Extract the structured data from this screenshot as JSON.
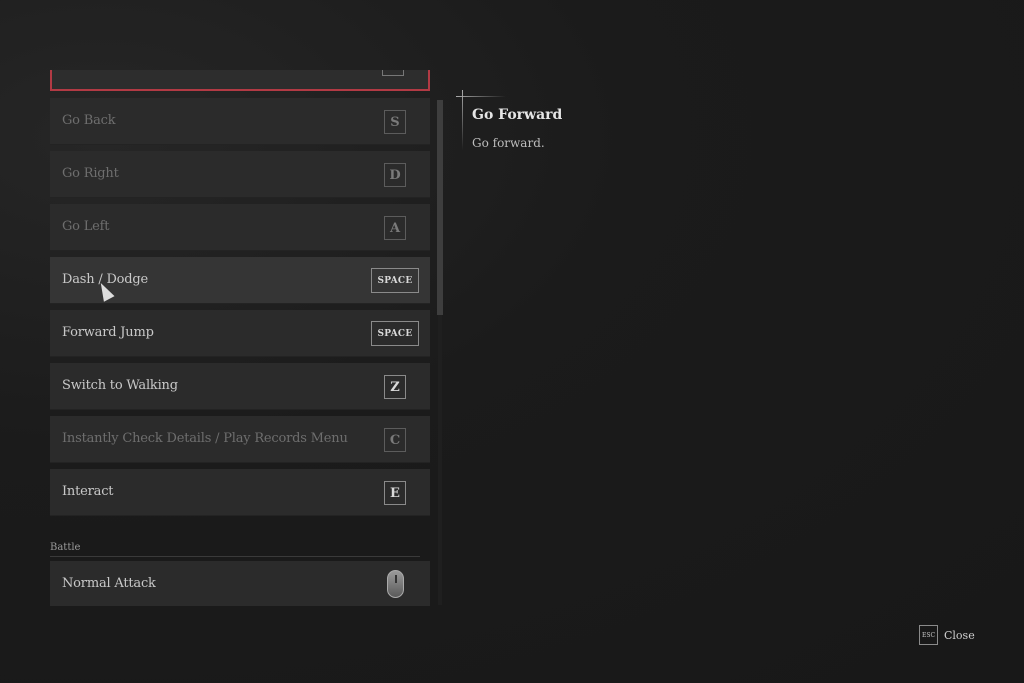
{
  "controls": {
    "rows": [
      {
        "label": "",
        "key": "",
        "state": "selected"
      },
      {
        "label": "Go Back",
        "key": "S",
        "state": "dim"
      },
      {
        "label": "Go Right",
        "key": "D",
        "state": "dim"
      },
      {
        "label": "Go Left",
        "key": "A",
        "state": "dim"
      },
      {
        "label": "Dash / Dodge",
        "key": "SPACE",
        "state": "hover"
      },
      {
        "label": "Forward Jump",
        "key": "SPACE",
        "state": "normal"
      },
      {
        "label": "Switch to Walking",
        "key": "Z",
        "state": "normal"
      },
      {
        "label": "Instantly Check Details / Play Records Menu",
        "key": "C",
        "state": "dim"
      },
      {
        "label": "Interact",
        "key": "E",
        "state": "normal"
      }
    ],
    "section_battle": "Battle",
    "battle_rows": [
      {
        "label": "Normal Attack",
        "key_icon": "mouse-left-icon"
      }
    ]
  },
  "detail": {
    "title": "Go Forward",
    "description": "Go forward."
  },
  "footer": {
    "esc_key": "ESC",
    "close_label": "Close"
  },
  "colors": {
    "selection_border": "#b23a44"
  }
}
